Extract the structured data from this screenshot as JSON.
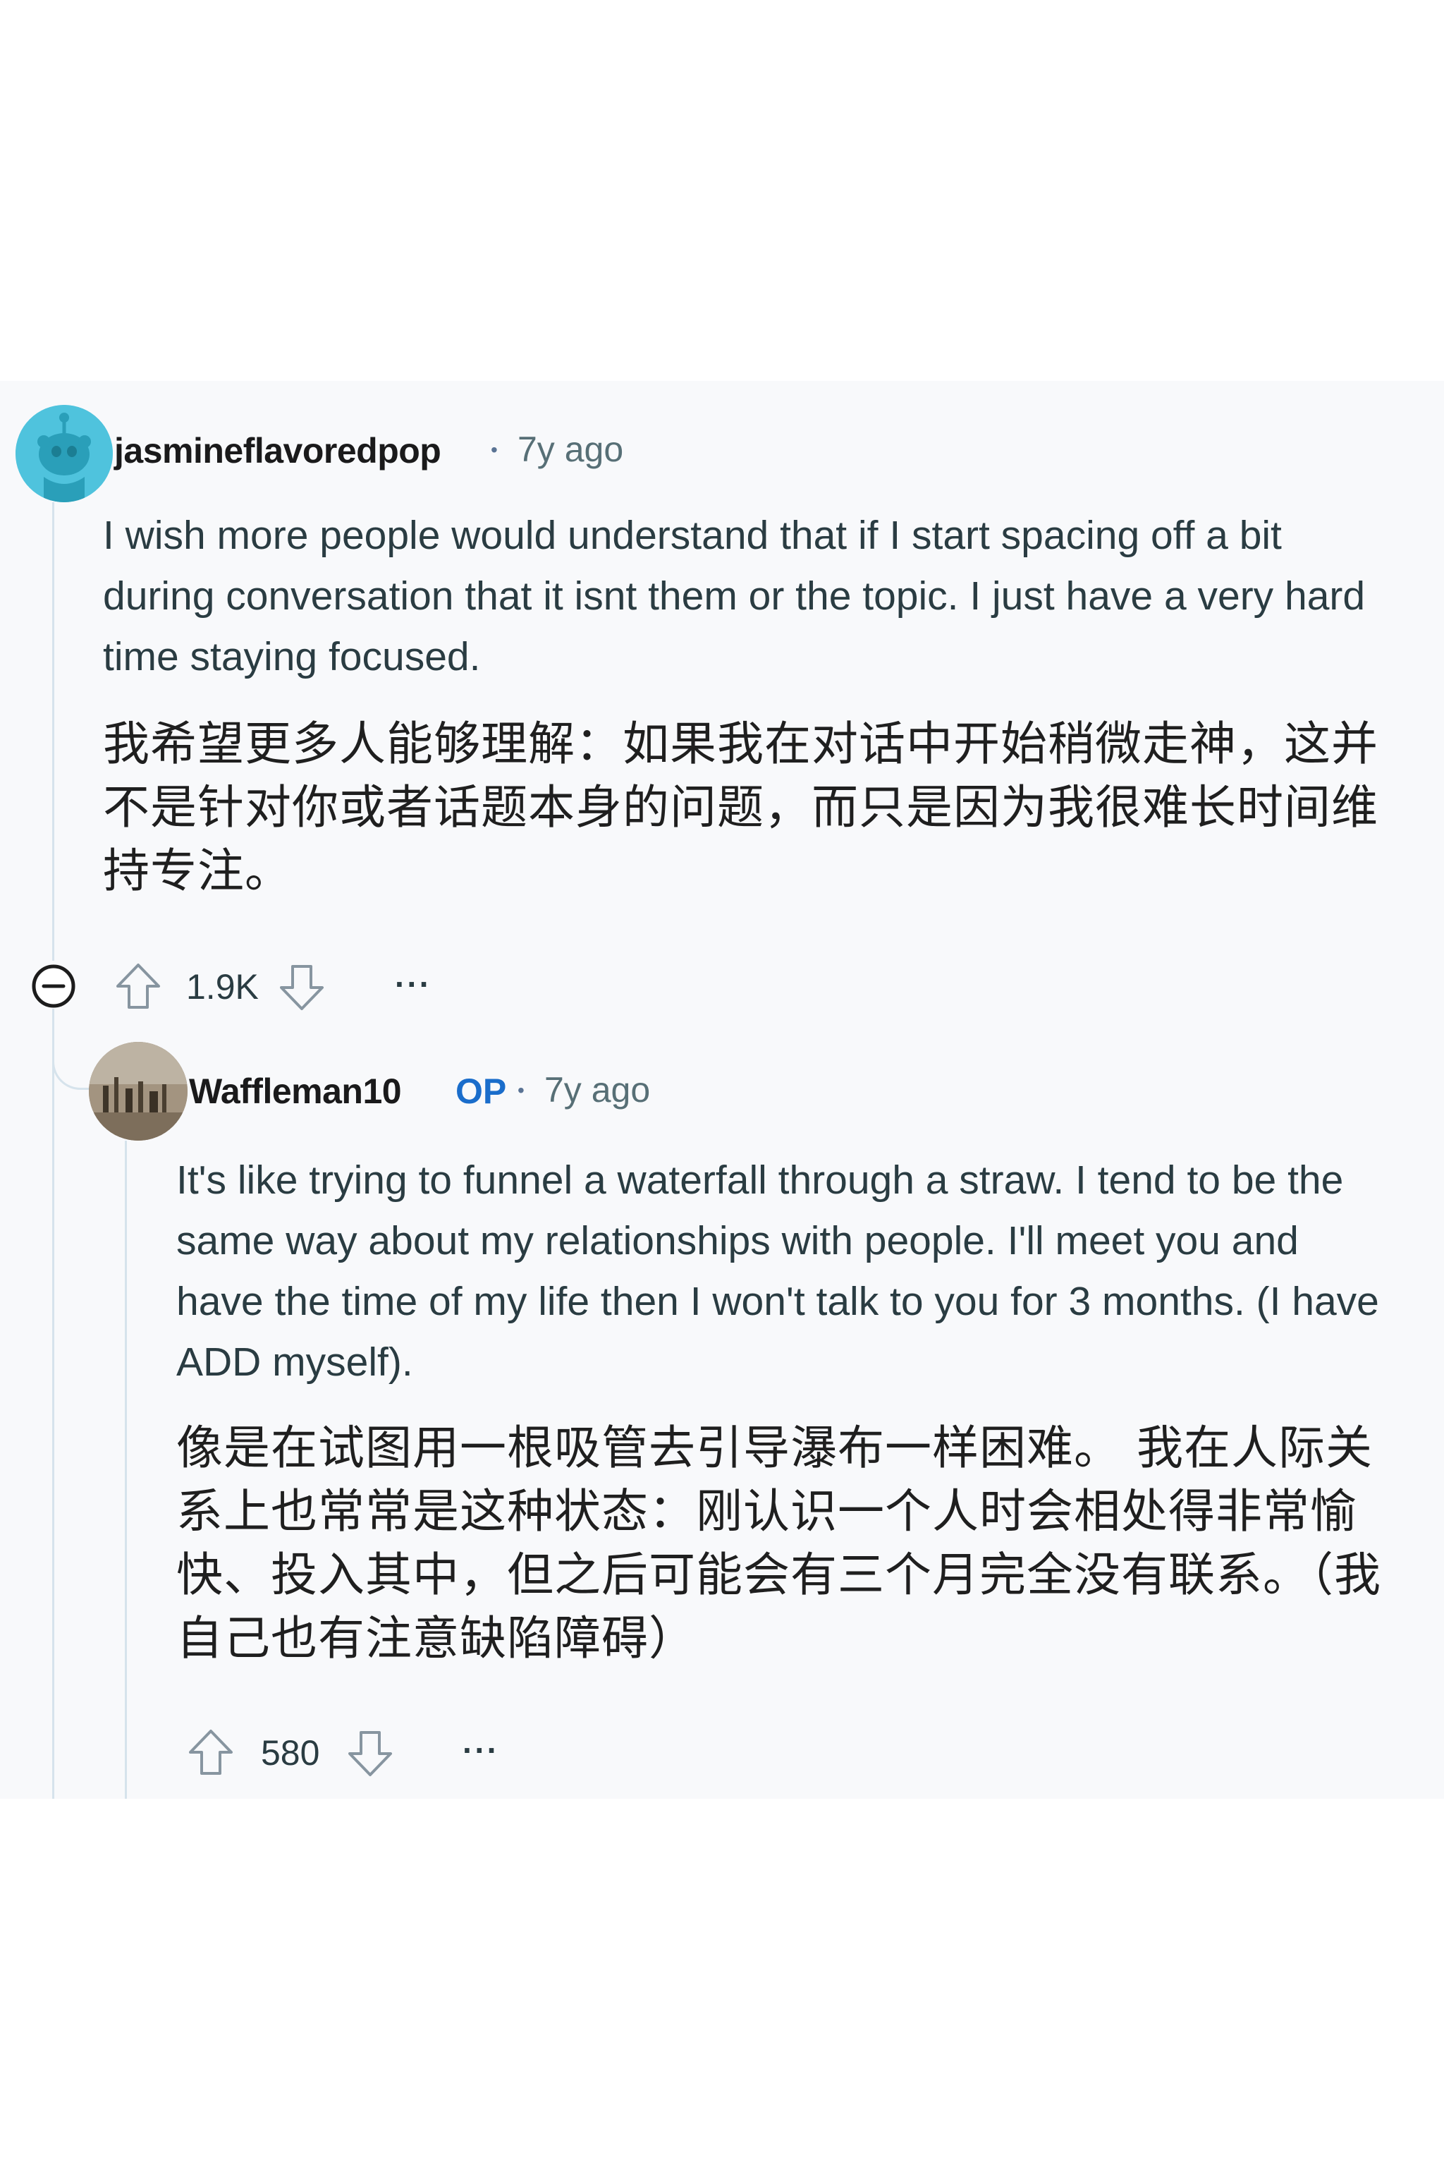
{
  "comments": [
    {
      "username": "jasmineflavoredpop",
      "time": "7y ago",
      "body_en": "I wish more people would understand that if I start spacing off a bit during conversation that it isnt them or the topic. I just have a very hard time staying focused.",
      "body_zh": "我希望更多人能够理解：如果我在对话中开始稍微走神，这并不是针对你或者话题本身的问题，而只是因为我很难长时间维持专注。",
      "score": "1.9K",
      "more": "···"
    },
    {
      "username": "Waffleman10",
      "op_badge": "OP",
      "time": "7y ago",
      "body_en": "It's like trying to funnel a waterfall through a straw. I tend to be the same way about my relationships with people. I'll meet you and have the time of my life then I won't talk to you for 3 months. (I have ADD myself).",
      "body_zh": "像是在试图用一根吸管去引导瀑布一样困难。 我在人际关系上也常常是这种状态：刚认识一个人时会相处得非常愉快、投入其中，但之后可能会有三个月完全没有联系。（我自己也有注意缺陷障碍）",
      "score": "580",
      "more": "···"
    }
  ],
  "icons": {
    "collapse": "collapse-minus-icon",
    "upvote": "upvote-arrow-icon",
    "downvote": "downvote-arrow-icon"
  },
  "colors": {
    "op_badge": "#1a6dcb",
    "thread_line": "#d6e3ec",
    "avatar_1": "#4fc3dd"
  }
}
